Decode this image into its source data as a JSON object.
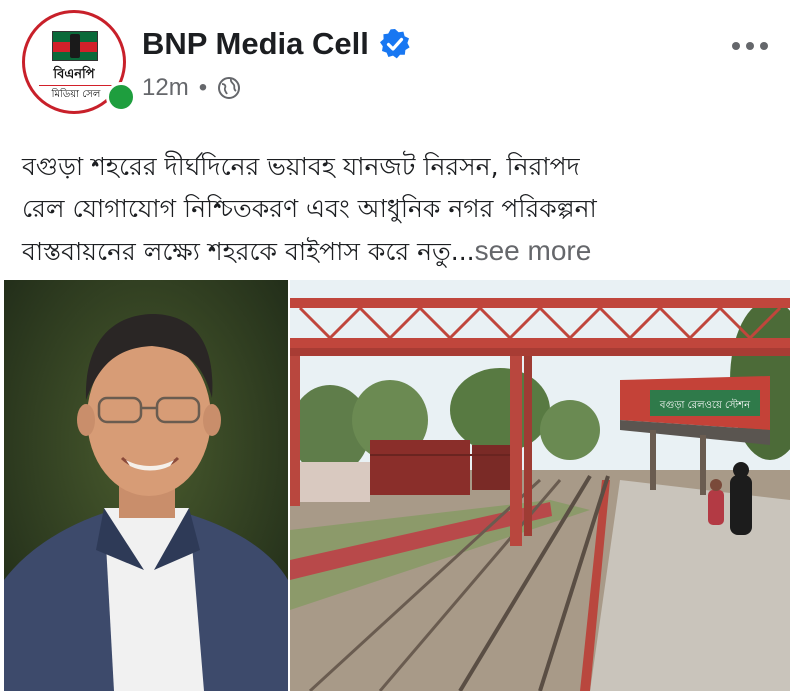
{
  "post": {
    "page_name": "BNP Media Cell",
    "timestamp": "12m",
    "separator": "•",
    "avatar": {
      "logo_line1": "বিএনপি",
      "logo_line2": "মিডিয়া সেল"
    },
    "text_lines": [
      "বগুড়া শহরের দীর্ঘদিনের ভয়াবহ যানজট নিরসন, নিরাপদ",
      "রেল যোগাযোগ নিশ্চিতকরণ এবং আধুনিক নগর পরিকল্পনা",
      "বাস্তবায়নের লক্ষ্যে শহরকে বাইপাস করে নতু..."
    ],
    "see_more": "see more",
    "station_sign": "বগুড়া রেলওয়ে স্টেশন"
  },
  "colors": {
    "verified": "#1877f2",
    "online": "#1e9e3e",
    "meta_gray": "#65676b",
    "bridge_red": "#c0463c"
  },
  "icons": {
    "verified": "verified-badge-icon",
    "audience": "globe-icon",
    "more": "more-options-icon"
  }
}
